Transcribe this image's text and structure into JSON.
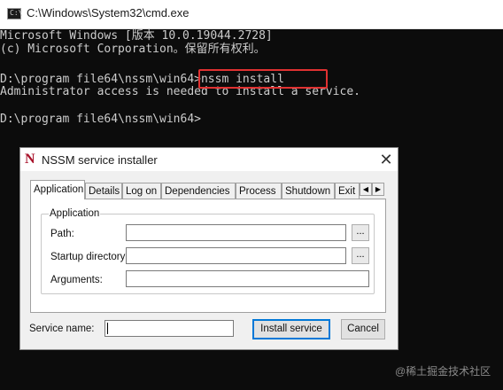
{
  "cmd": {
    "title": "C:\\Windows\\System32\\cmd.exe",
    "icon": "cmd-icon",
    "lines": [
      "Microsoft Windows [版本 10.0.19044.2728]",
      "(c) Microsoft Corporation。保留所有权利。",
      "",
      "D:\\program file64\\nssm\\win64>nssm install",
      "Administrator access is needed to install a service.",
      "",
      "D:\\program file64\\nssm\\win64>"
    ],
    "highlight_color": "#e03131"
  },
  "dialog": {
    "logo": "N",
    "title": "NSSM service installer",
    "close": "✕",
    "tabs": [
      "Application",
      "Details",
      "Log on",
      "Dependencies",
      "Process",
      "Shutdown",
      "Exit"
    ],
    "active_tab": "Application",
    "scroll_left": "◀",
    "scroll_right": "▶",
    "group_label": "Application",
    "fields": {
      "path_label": "Path:",
      "path_value": "",
      "startup_label": "Startup directory:",
      "startup_value": "",
      "arguments_label": "Arguments:",
      "arguments_value": ""
    },
    "browse_label": "...",
    "service_name_label": "Service name:",
    "service_name_value": "",
    "install_button": "Install service",
    "cancel_button": "Cancel"
  },
  "watermark": "@稀土掘金技术社区"
}
